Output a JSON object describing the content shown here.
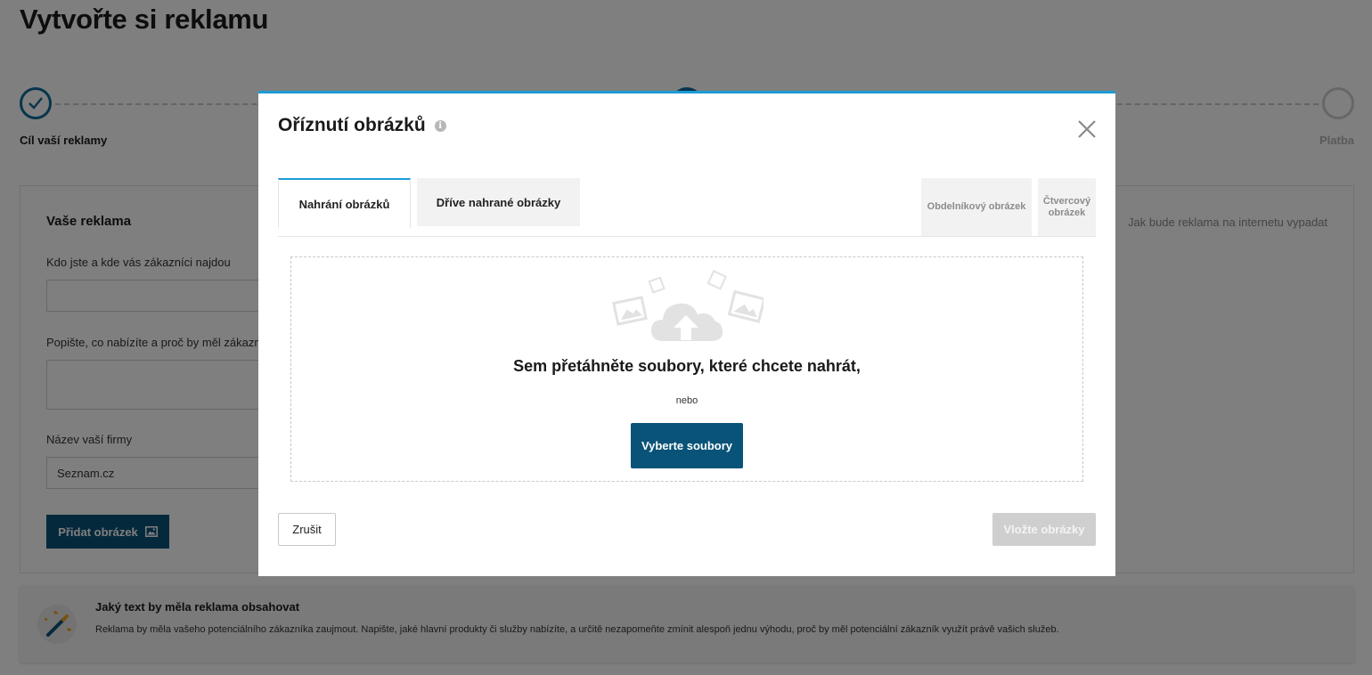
{
  "page": {
    "title": "Vytvořte si reklamu",
    "steps": [
      {
        "label": "Cíl vaší reklamy",
        "state": "done"
      },
      {
        "label": "",
        "state": "current"
      },
      {
        "label": "Platba",
        "state": "todo"
      }
    ],
    "card": {
      "title": "Vaše reklama",
      "preview_title": "Jak bude reklama na internetu vypadat",
      "fields": [
        {
          "label": "Kdo jste a kde vás zákazníci najdou",
          "value": ""
        },
        {
          "label": "Popište, co nabízíte a proč by měl zákazník",
          "value": ""
        },
        {
          "label": "Název vaší firmy",
          "value": "Seznam.cz"
        }
      ],
      "add_image_label": "Přidat obrázek"
    },
    "tip": {
      "title": "Jaký text by měla reklama obsahovat",
      "text": "Reklama by měla vašeho potenciálního zákazníka zaujmout. Napište, jaké hlavní produkty či služby nabízíte, a určitě nezapomeňte zmínit alespoň jednu výhodu, proč by měl potenciální zákazník využít právě vašich služeb."
    }
  },
  "modal": {
    "title": "Oříznutí obrázků",
    "tabs": {
      "upload": "Nahrání obrázků",
      "previous": "Dříve nahrané obrázky",
      "rect": "Obdelníkový obrázek",
      "square": "Čtvercový obrázek"
    },
    "dropzone": {
      "title": "Sem přetáhněte soubory, které chcete nahrát,",
      "or": "nebo",
      "choose_label": "Vyberte soubory"
    },
    "cancel_label": "Zrušit",
    "insert_label": "Vložte obrázky"
  },
  "colors": {
    "accent": "#1d9bd6",
    "primary_button": "#0a5378",
    "disabled_button": "#cfcfcf",
    "overlay": "rgba(0,0,0,0.5)"
  },
  "icons": {
    "info": "info-icon",
    "close": "close-icon",
    "upload": "cloud-upload-icon",
    "image": "image-icon",
    "magic_wand": "magic-wand-icon",
    "check": "check-icon"
  }
}
